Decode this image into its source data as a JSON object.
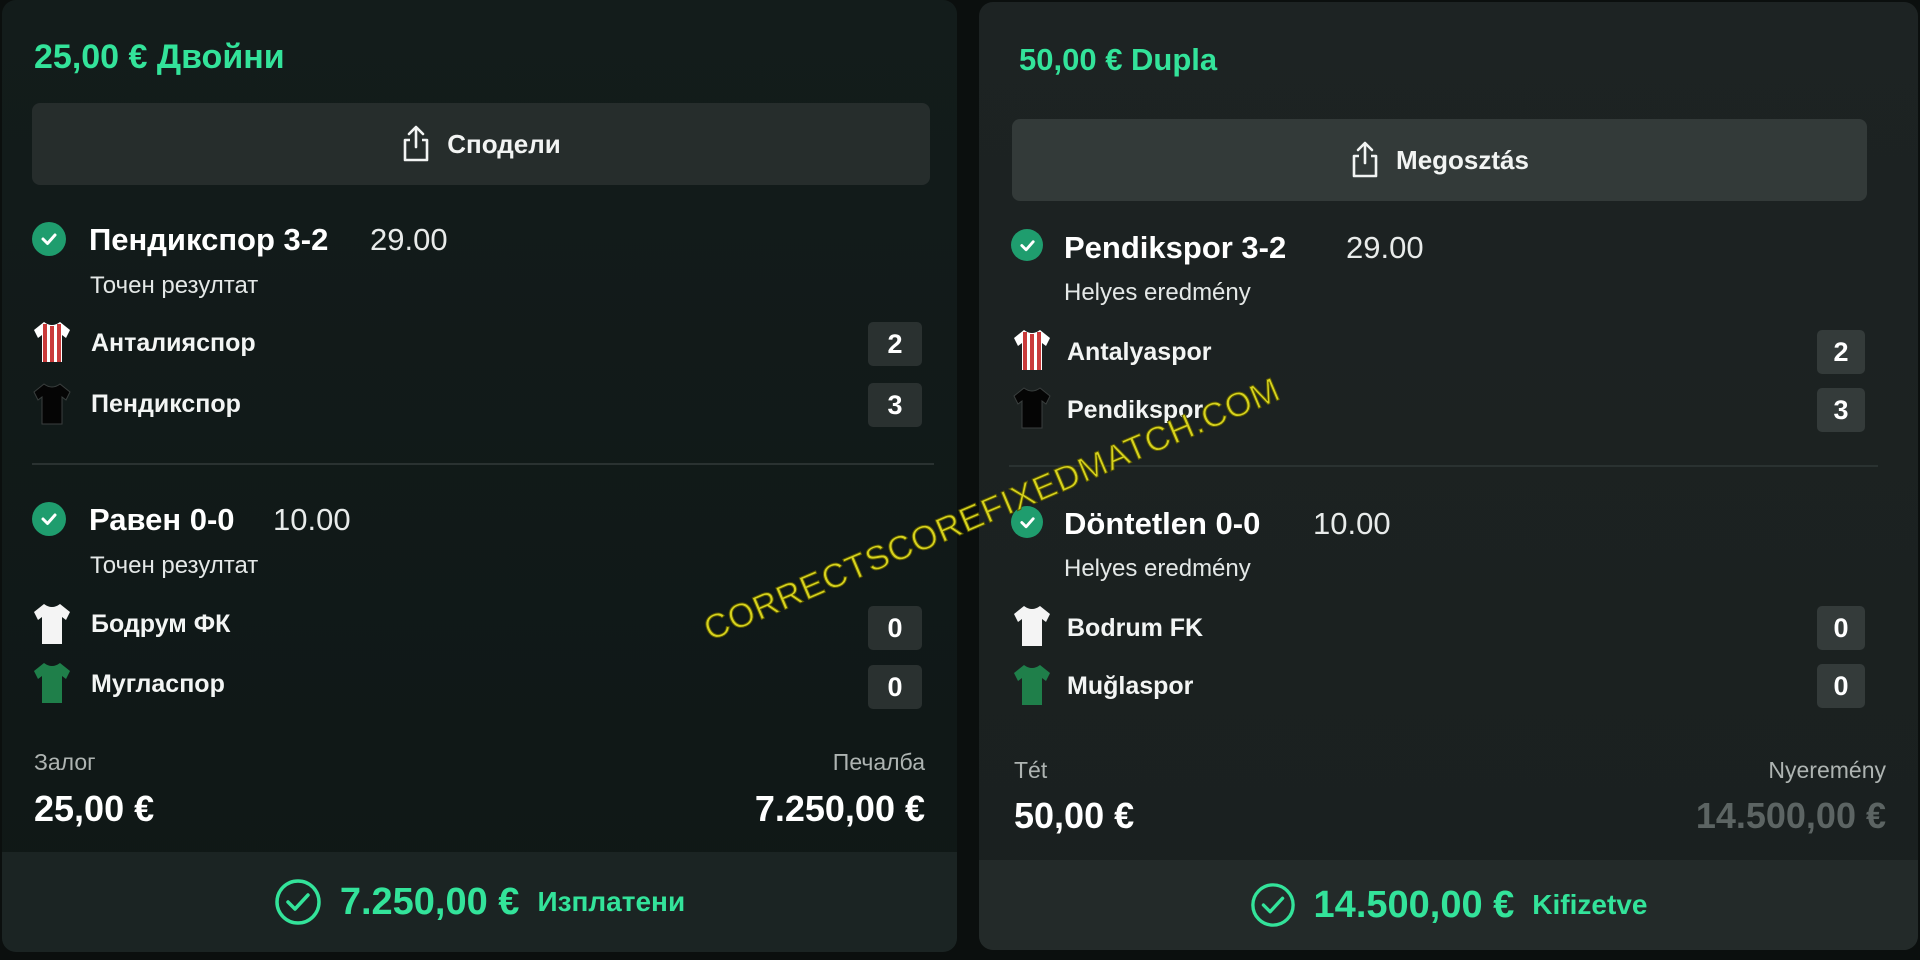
{
  "left": {
    "title": "25,00 € Двойни",
    "share_label": "Сподели",
    "selections": [
      {
        "name": "Пендикспор 3-2",
        "odds": "29.00",
        "market": "Точен резултат",
        "home": {
          "team": "Анталияспор",
          "score": "2"
        },
        "away": {
          "team": "Пендикспор",
          "score": "3"
        }
      },
      {
        "name": "Равен 0-0",
        "odds": "10.00",
        "market": "Точен резултат",
        "home": {
          "team": "Бодрум ФК",
          "score": "0"
        },
        "away": {
          "team": "Мугласпор",
          "score": "0"
        }
      }
    ],
    "stake_label": "Залог",
    "stake": "25,00 €",
    "win_label": "Печалба",
    "win": "7.250,00 €",
    "footer_amount": "7.250,00 €",
    "footer_status": "Изплатени"
  },
  "right": {
    "title": "50,00 € Dupla",
    "share_label": "Megosztás",
    "selections": [
      {
        "name": "Pendikspor 3-2",
        "odds": "29.00",
        "market": "Helyes eredmény",
        "home": {
          "team": "Antalyaspor",
          "score": "2"
        },
        "away": {
          "team": "Pendikspor",
          "score": "3"
        }
      },
      {
        "name": "Döntetlen 0-0",
        "odds": "10.00",
        "market": "Helyes eredmény",
        "home": {
          "team": "Bodrum FK",
          "score": "0"
        },
        "away": {
          "team": "Muğlaspor",
          "score": "0"
        }
      }
    ],
    "stake_label": "Tét",
    "stake": "50,00 €",
    "win_label": "Nyeremény",
    "win": "14.500,00 €",
    "footer_amount": "14.500,00 €",
    "footer_status": "Kifizetve"
  },
  "watermark": "CORRECTSCOREFIXEDMATCH.COM",
  "colors": {
    "accent": "#33e39a",
    "check": "#1f9d6e",
    "watermark": "#d7d31f"
  }
}
